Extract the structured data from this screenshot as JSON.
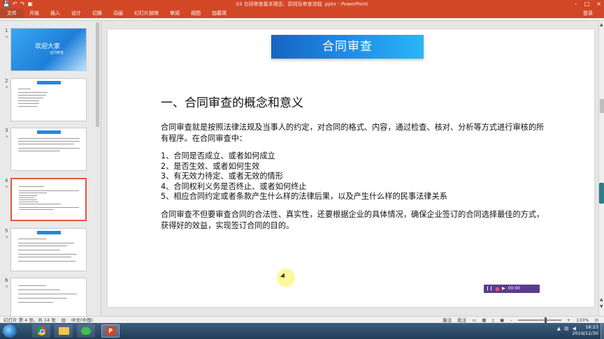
{
  "window": {
    "title": "03 合同审查基本理念、原则及审查流程 .pptx - PowerPoint",
    "minimize": "–",
    "restore": "□",
    "close": "×",
    "qat_save": "💾",
    "qat_undo": "↶",
    "qat_redo": "↷",
    "qat_present": "▣"
  },
  "ribbon": {
    "tabs": [
      "文件",
      "开始",
      "插入",
      "设计",
      "切换",
      "动画",
      "幻灯片放映",
      "审阅",
      "视图",
      "加载项"
    ],
    "login": "登录"
  },
  "thumbnails": [
    {
      "num": "1",
      "star": "*",
      "title": "欢迎大家",
      "subtitle": "合同审查"
    },
    {
      "num": "2",
      "star": "*"
    },
    {
      "num": "3",
      "star": "*"
    },
    {
      "num": "4",
      "star": "*"
    },
    {
      "num": "5",
      "star": "*"
    },
    {
      "num": "6",
      "star": "*"
    }
  ],
  "slide": {
    "banner": "合同审查",
    "heading": "一、合同审查的概念和意义",
    "para1": "合同审查就是按照法律法规及当事人的约定，对合同的格式、内容，通过检查、核对、分析等方式进行审核的所有程序。在合同审查中：",
    "list": [
      "1、合同是否成立、或者如何成立",
      "2、是否生效、或者如何生效",
      "3、有无效力待定、或者无效的情形",
      "4、合同权利义务是否终止、或者如何终止",
      "5、相应合同约定或者条款产生什么样的法律后果，以及产生什么样的民事法律关系"
    ],
    "para2": "合同审查不但要审查合同的合法性、真实性，还要根据企业的具体情况，确保企业签订的合同选择最佳的方式，获得好的效益，实现签订合同的目的。",
    "recorder_time": "00:00"
  },
  "status": {
    "slide_info": "幻灯片 第 4 张，共 14 张",
    "language": "中文(中国)",
    "notes": "备注",
    "comments": "批注",
    "zoom": "133%"
  },
  "taskbar": {
    "ppt_letter": "P",
    "time": "18:23",
    "date": "2019/12/30"
  },
  "colors": {
    "accent": "#d24726",
    "banner_blue": "#1e88e5",
    "selected_thumb": "#e1573a"
  }
}
